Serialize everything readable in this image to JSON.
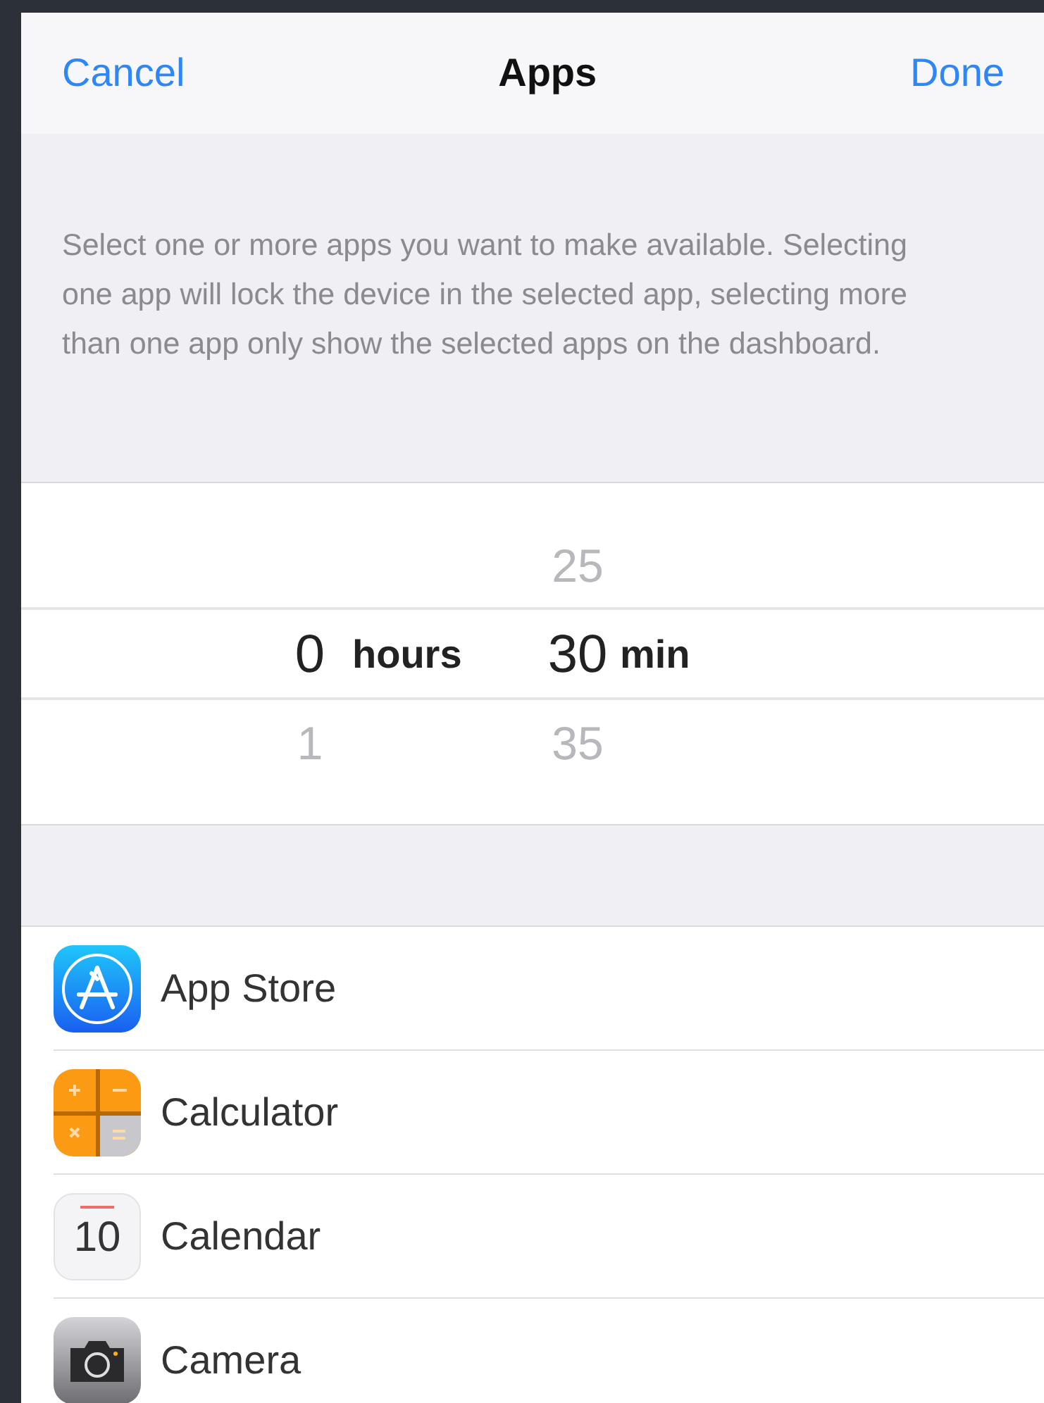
{
  "nav_bar": {
    "cancel": "Cancel",
    "title": "Apps",
    "done": "Done"
  },
  "description": "Select one or more apps you want to make available. Selecting one app will lock the device in the selected app, selecting more than one app only show the selected apps on the dashboard.",
  "picker": {
    "columns": [
      {
        "unit": "hours",
        "values": [
          {
            "label": "0",
            "selected": true
          },
          {
            "label": "1",
            "selected": false
          }
        ]
      },
      {
        "unit": "min",
        "values": [
          {
            "label": "25",
            "selected": false
          },
          {
            "label": "30",
            "selected": true
          },
          {
            "label": "35",
            "selected": false
          }
        ]
      }
    ]
  },
  "apps": [
    {
      "name": "App Store",
      "kind": "appstore"
    },
    {
      "name": "Calculator",
      "kind": "calculator"
    },
    {
      "name": "Calendar",
      "kind": "calendar",
      "icon_text": "10"
    },
    {
      "name": "Camera",
      "kind": "camera"
    }
  ]
}
